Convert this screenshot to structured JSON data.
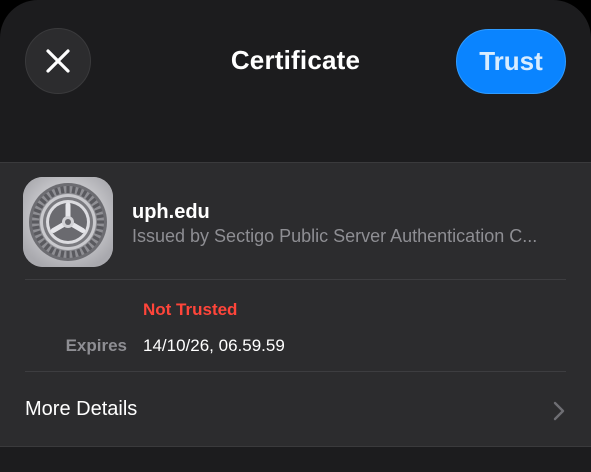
{
  "header": {
    "title": "Certificate",
    "close_icon": "xmark-icon",
    "trust_label": "Trust",
    "accent_color": "#0a84ff"
  },
  "certificate": {
    "icon": "gear-settings-icon",
    "name": "uph.edu",
    "issuer": "Issued by Sectigo Public Server Authentication C...",
    "status": "Not Trusted",
    "status_color": "#ff453a",
    "expires_label": "Expires",
    "expires_value": "14/10/26, 06.59.59"
  },
  "more_details": {
    "label": "More Details",
    "chevron_icon": "chevron-right-icon"
  }
}
